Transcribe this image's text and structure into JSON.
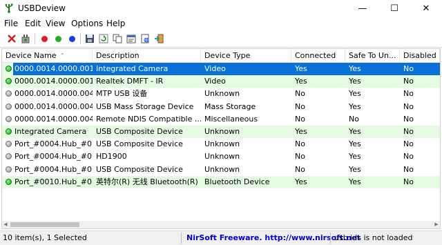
{
  "window": {
    "title": "USBDeview",
    "minimize": "—",
    "maximize": "☐",
    "close": "✕"
  },
  "menu": [
    "File",
    "Edit",
    "View",
    "Options",
    "Help"
  ],
  "toolbar": {
    "buttons": [
      "delete-icon",
      "plug-disconnect-icon",
      "red-dot-icon",
      "green-dot-icon",
      "blue-dot-icon",
      "save-icon",
      "refresh-icon",
      "copy-icon",
      "properties-icon",
      "html-report-icon",
      "exit-icon"
    ],
    "colors": {
      "red": "#e02020",
      "green": "#20b020",
      "blue": "#1e3ed8"
    }
  },
  "columns": [
    "Device Name",
    "Description",
    "Device Type",
    "Connected",
    "Safe To Un...",
    "Disabled"
  ],
  "rows": [
    {
      "name": "0000.0014.0000.001....",
      "description": "Integrated Camera",
      "type": "Video",
      "connected": "Yes",
      "safe": "Yes",
      "disabled": "No",
      "status": "connected",
      "selected": true
    },
    {
      "name": "0000.0014.0000.001....",
      "description": "Realtek DMFT - IR",
      "type": "Video",
      "connected": "Yes",
      "safe": "Yes",
      "disabled": "No",
      "status": "connected",
      "selected": false
    },
    {
      "name": "0000.0014.0000.004....",
      "description": "MTP USB 设备",
      "type": "Unknown",
      "connected": "No",
      "safe": "Yes",
      "disabled": "No",
      "status": "disconnected",
      "selected": false
    },
    {
      "name": "0000.0014.0000.004....",
      "description": "USB Mass Storage Device",
      "type": "Mass Storage",
      "connected": "No",
      "safe": "Yes",
      "disabled": "No",
      "status": "disconnected",
      "selected": false
    },
    {
      "name": "0000.0014.0000.004....",
      "description": "Remote NDIS Compatible ...",
      "type": "Miscellaneous",
      "connected": "No",
      "safe": "No",
      "disabled": "No",
      "status": "disconnected",
      "selected": false
    },
    {
      "name": "Integrated Camera",
      "description": "USB Composite Device",
      "type": "Unknown",
      "connected": "Yes",
      "safe": "Yes",
      "disabled": "No",
      "status": "connected",
      "selected": false
    },
    {
      "name": "Port_#0004.Hub_#0...",
      "description": "USB Composite Device",
      "type": "Unknown",
      "connected": "No",
      "safe": "Yes",
      "disabled": "No",
      "status": "disconnected",
      "selected": false
    },
    {
      "name": "Port_#0004.Hub_#0...",
      "description": "HD1900",
      "type": "Unknown",
      "connected": "No",
      "safe": "Yes",
      "disabled": "No",
      "status": "disconnected",
      "selected": false
    },
    {
      "name": "Port_#0004.Hub_#0...",
      "description": "USB Composite Device",
      "type": "Unknown",
      "connected": "No",
      "safe": "Yes",
      "disabled": "No",
      "status": "disconnected",
      "selected": false
    },
    {
      "name": "Port_#0010.Hub_#0...",
      "description": "英特尔(R) 无线 Bluetooth(R)",
      "type": "Bluetooth Device",
      "connected": "Yes",
      "safe": "Yes",
      "disabled": "No",
      "status": "connected",
      "selected": false
    }
  ],
  "status": {
    "count": "10 item(s), 1 Selected",
    "credit": "NirSoft Freeware.  http://www.nirsoft.net",
    "ids": "usb.ids is not loaded"
  },
  "colors": {
    "selection": "#0a6fd6",
    "connected_row": "#e5fbe2",
    "link": "#0000cc"
  }
}
